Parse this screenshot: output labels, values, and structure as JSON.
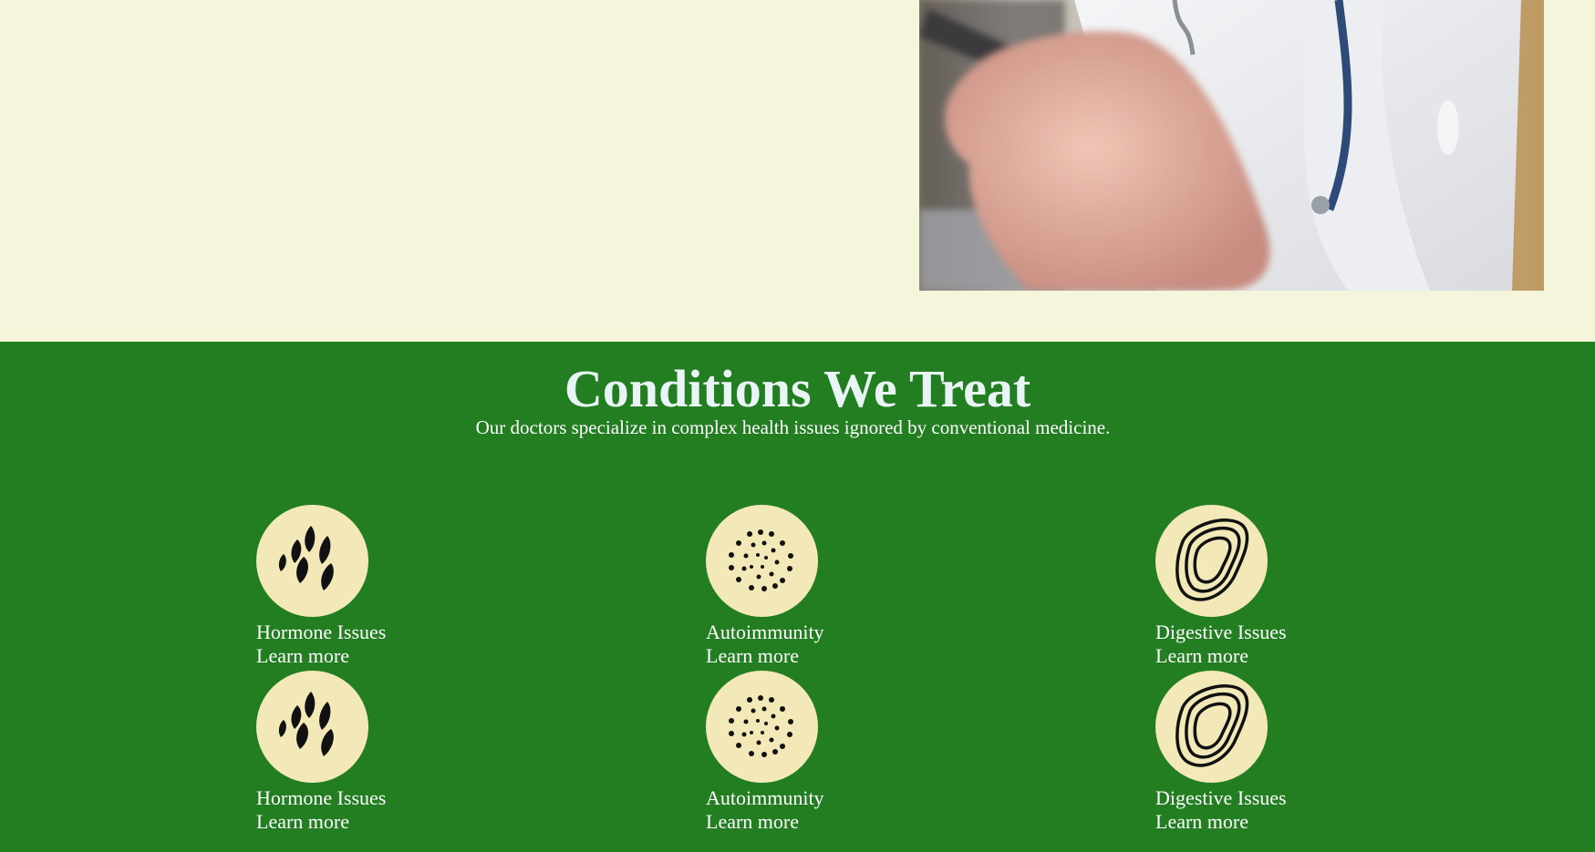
{
  "conditions": {
    "title": "Conditions We Treat",
    "subtitle": "Our doctors specialize in complex health issues ignored by conventional medicine.",
    "cards": [
      {
        "title": "Hormone Issues",
        "link": "Learn more",
        "icon": "hormone-icon"
      },
      {
        "title": "Autoimmunity",
        "link": "Learn more",
        "icon": "autoimmunity-icon"
      },
      {
        "title": "Digestive Issues",
        "link": "Learn more",
        "icon": "digestive-icon"
      },
      {
        "title": "Hormone Issues",
        "link": "Learn more",
        "icon": "hormone-icon"
      },
      {
        "title": "Autoimmunity",
        "link": "Learn more",
        "icon": "autoimmunity-icon"
      },
      {
        "title": "Digestive Issues",
        "link": "Learn more",
        "icon": "digestive-icon"
      }
    ]
  },
  "colors": {
    "cream_background": "#f5f5dc",
    "section_green": "#237e22",
    "badge_fill": "#f2e8b8",
    "title_color": "#e9f4f4"
  }
}
